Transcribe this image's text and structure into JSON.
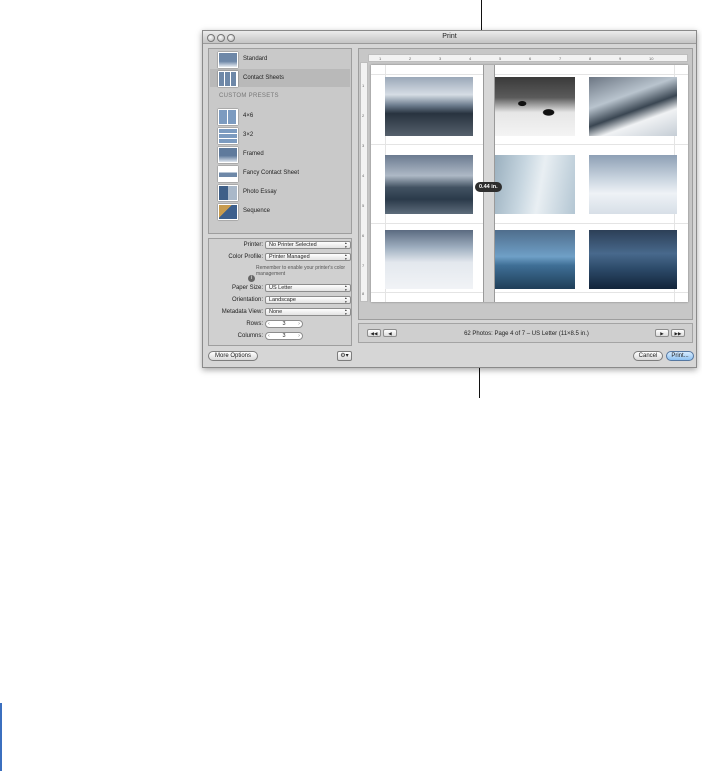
{
  "window": {
    "title": "Print"
  },
  "presets": {
    "standard": "Standard",
    "contact_sheets": "Contact Sheets",
    "custom_heading": "CUSTOM PRESETS",
    "custom": [
      "4×6",
      "3×2",
      "Framed",
      "Fancy Contact Sheet",
      "Photo Essay",
      "Sequence"
    ]
  },
  "settings": {
    "printer_label": "Printer:",
    "printer_value": "No Printer Selected",
    "color_profile_label": "Color Profile:",
    "color_profile_value": "Printer Managed",
    "notice": "Remember to enable your printer's color management",
    "paper_size_label": "Paper Size:",
    "paper_size_value": "US Letter",
    "orientation_label": "Orientation:",
    "orientation_value": "Landscape",
    "metadata_label": "Metadata View:",
    "metadata_value": "None",
    "rows_label": "Rows:",
    "rows_value": "3",
    "columns_label": "Columns:",
    "columns_value": "3"
  },
  "preview": {
    "ruler_numbers": [
      "1",
      "2",
      "3",
      "4",
      "5",
      "6",
      "7",
      "8",
      "9",
      "10"
    ],
    "vruler_numbers": [
      "1",
      "2",
      "3",
      "4",
      "5",
      "6",
      "7",
      "8"
    ],
    "dimension_label": "0.44 in.",
    "status": "62 Photos: Page 4 of 7 – US Letter (11×8.5 in.)",
    "nav_first": "◀◀",
    "nav_prev": "◀",
    "nav_next": "▶",
    "nav_last": "▶▶"
  },
  "buttons": {
    "more_options": "More Options",
    "gear": "⚙▾",
    "cancel": "Cancel",
    "print": "Print..."
  },
  "colors": {
    "primary_button": "#8ec2f2",
    "window_bg": "#d6d6d6"
  }
}
